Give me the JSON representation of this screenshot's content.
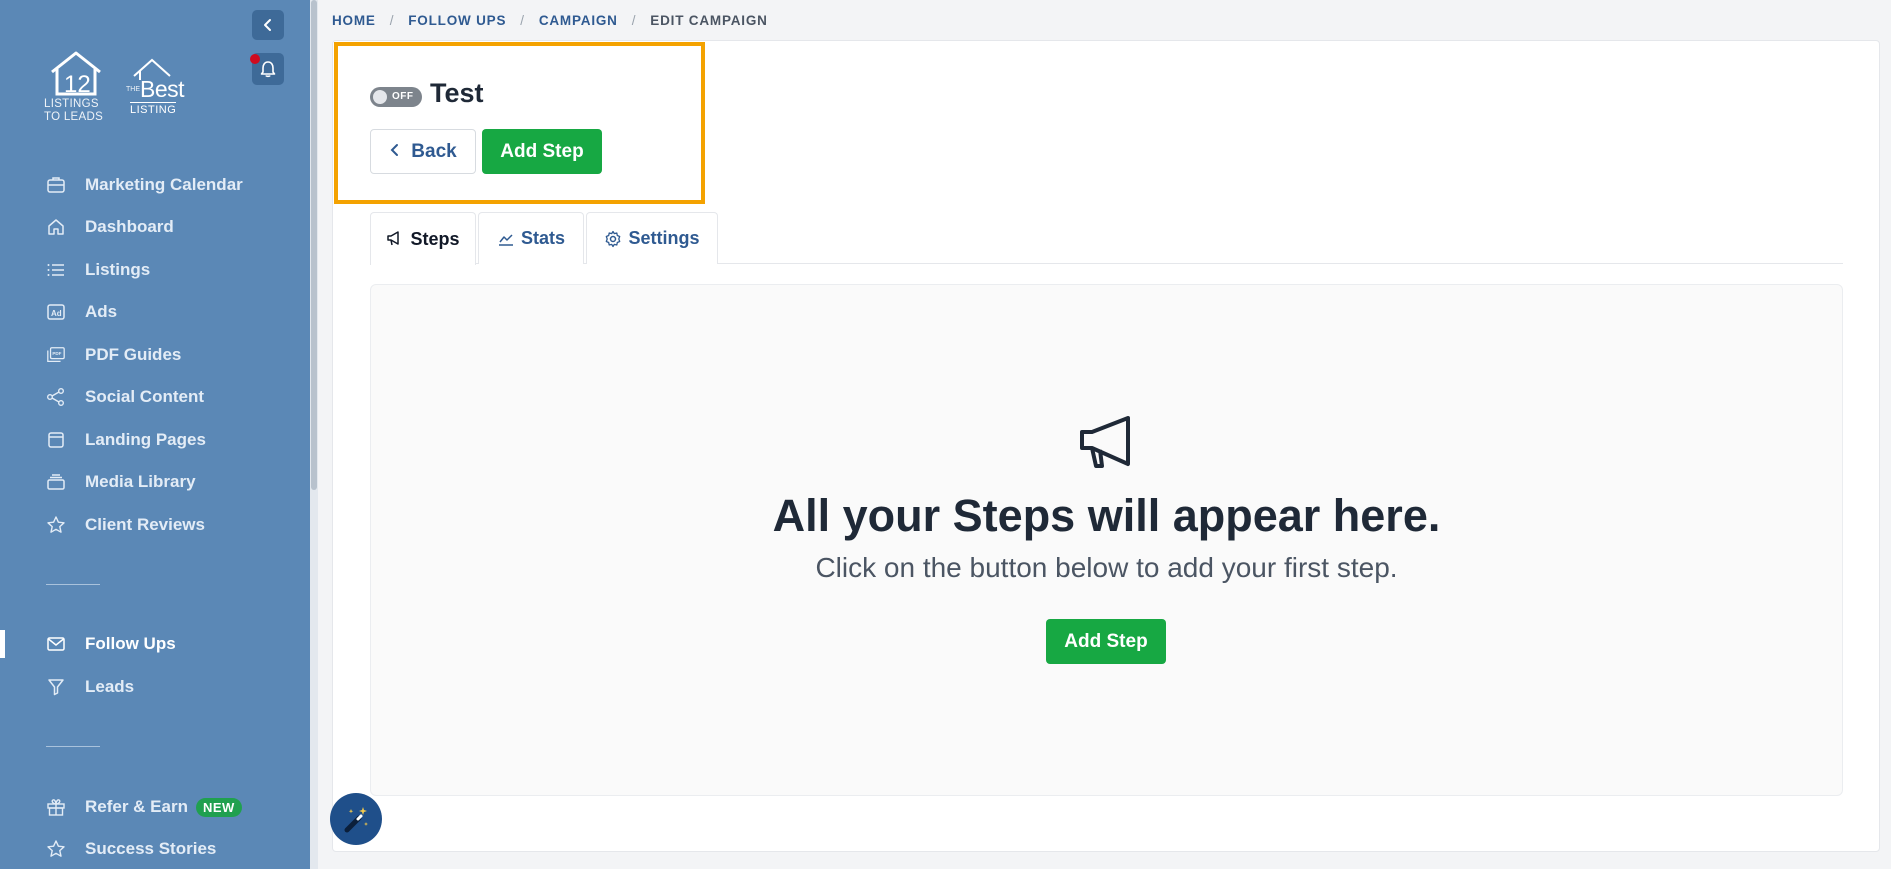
{
  "brand": {
    "logo1_text_line1": "LISTINGS",
    "logo1_text_line2": "TO LEADS",
    "logo1_number": "12",
    "logo2_the": "THE",
    "logo2_best": "Best",
    "logo2_listing": "LISTING"
  },
  "sidebar": {
    "items": [
      {
        "label": "Marketing Calendar",
        "icon": "briefcase-icon"
      },
      {
        "label": "Dashboard",
        "icon": "home-icon"
      },
      {
        "label": "Listings",
        "icon": "list-icon"
      },
      {
        "label": "Ads",
        "icon": "ad-icon"
      },
      {
        "label": "PDF Guides",
        "icon": "pdf-icon"
      },
      {
        "label": "Social Content",
        "icon": "share-icon"
      },
      {
        "label": "Landing Pages",
        "icon": "window-icon"
      },
      {
        "label": "Media Library",
        "icon": "stack-icon"
      },
      {
        "label": "Client Reviews",
        "icon": "star-icon"
      }
    ],
    "items2": [
      {
        "label": "Follow Ups",
        "icon": "mail-icon"
      },
      {
        "label": "Leads",
        "icon": "filter-icon"
      }
    ],
    "items3": [
      {
        "label": "Refer & Earn",
        "icon": "gift-icon",
        "badge": "NEW"
      },
      {
        "label": "Success Stories",
        "icon": "star-icon"
      }
    ]
  },
  "breadcrumb": {
    "home": "HOME",
    "follow_ups": "FOLLOW UPS",
    "campaign": "CAMPAIGN",
    "current": "EDIT CAMPAIGN",
    "separator": "/"
  },
  "campaign": {
    "toggle_label": "OFF",
    "title": "Test",
    "back_label": "Back",
    "add_step_label": "Add Step"
  },
  "tabs": [
    {
      "label": "Steps",
      "icon": "megaphone-icon"
    },
    {
      "label": "Stats",
      "icon": "chart-line-icon"
    },
    {
      "label": "Settings",
      "icon": "gear-icon"
    }
  ],
  "empty_state": {
    "title": "All your Steps will appear here.",
    "subtitle": "Click on the button below to add your first step.",
    "button_label": "Add Step"
  },
  "colors": {
    "sidebar_bg": "#5b88b6",
    "accent_green": "#17a843",
    "link_blue": "#2f5a91",
    "highlight_orange": "#f4a200",
    "notification_red": "#d00b1f"
  }
}
